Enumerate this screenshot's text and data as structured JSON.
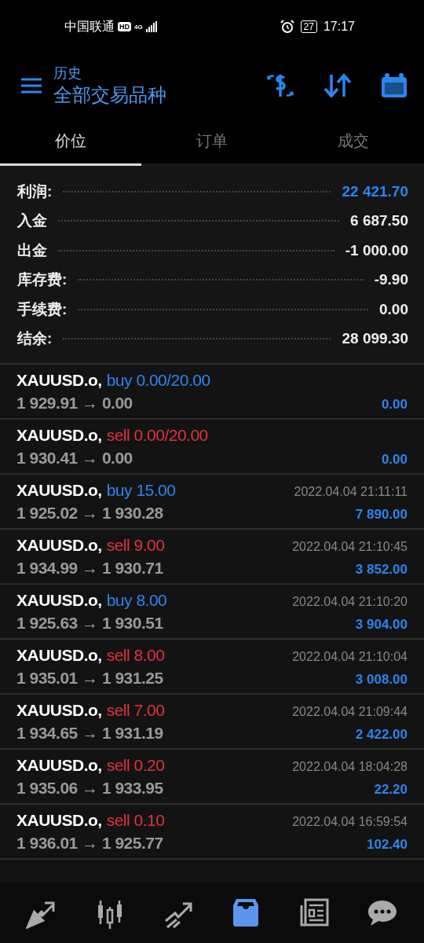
{
  "status_bar": {
    "carrier": "中国联通",
    "hd": "HD",
    "network": "4G",
    "battery": "27",
    "time": "17:17"
  },
  "header": {
    "subtitle": "历史",
    "title": "全部交易品种"
  },
  "tabs": [
    {
      "label": "价位",
      "selected": true
    },
    {
      "label": "订单",
      "selected": false
    },
    {
      "label": "成交",
      "selected": false
    }
  ],
  "summary": [
    {
      "label": "利润:",
      "value": "22 421.70",
      "highlight": true
    },
    {
      "label": "入金",
      "value": "6 687.50",
      "highlight": false
    },
    {
      "label": "出金",
      "value": "-1 000.00",
      "highlight": false
    },
    {
      "label": "库存费:",
      "value": "-9.90",
      "highlight": false
    },
    {
      "label": "手续费:",
      "value": "0.00",
      "highlight": false
    },
    {
      "label": "结余:",
      "value": "28 099.30",
      "highlight": false
    }
  ],
  "trades": [
    {
      "symbol": "XAUUSD.o,",
      "kind": "buy",
      "order": "buy 0.00/20.00",
      "prices": "1 929.91 → 0.00",
      "profit": "0.00"
    },
    {
      "symbol": "XAUUSD.o,",
      "kind": "sell",
      "order": "sell 0.00/20.00",
      "prices": "1 930.41 → 0.00",
      "profit": "0.00"
    },
    {
      "symbol": "XAUUSD.o,",
      "kind": "buy",
      "order": "buy 15.00",
      "prices": "1 925.02 → 1 930.28",
      "time": "2022.04.04 21:11:11",
      "profit": "7 890.00"
    },
    {
      "symbol": "XAUUSD.o,",
      "kind": "sell",
      "order": "sell 9.00",
      "prices": "1 934.99 → 1 930.71",
      "time": "2022.04.04 21:10:45",
      "profit": "3 852.00"
    },
    {
      "symbol": "XAUUSD.o,",
      "kind": "buy",
      "order": "buy 8.00",
      "prices": "1 925.63 → 1 930.51",
      "time": "2022.04.04 21:10:20",
      "profit": "3 904.00"
    },
    {
      "symbol": "XAUUSD.o,",
      "kind": "sell",
      "order": "sell 8.00",
      "prices": "1 935.01 → 1 931.25",
      "time": "2022.04.04 21:10:04",
      "profit": "3 008.00"
    },
    {
      "symbol": "XAUUSD.o,",
      "kind": "sell",
      "order": "sell 7.00",
      "prices": "1 934.65 → 1 931.19",
      "time": "2022.04.04 21:09:44",
      "profit": "2 422.00"
    },
    {
      "symbol": "XAUUSD.o,",
      "kind": "sell",
      "order": "sell 0.20",
      "prices": "1 935.06 → 1 933.95",
      "time": "2022.04.04 18:04:28",
      "profit": "22.20"
    },
    {
      "symbol": "XAUUSD.o,",
      "kind": "sell",
      "order": "sell 0.10",
      "prices": "1 936.01 → 1 925.77",
      "time": "2022.04.04 16:59:54",
      "profit": "102.40"
    }
  ],
  "nav": [
    {
      "kind": "trade",
      "selected": false
    },
    {
      "kind": "chart",
      "selected": false
    },
    {
      "kind": "trend",
      "selected": false
    },
    {
      "kind": "history",
      "selected": true
    },
    {
      "kind": "news",
      "selected": false
    },
    {
      "kind": "chat",
      "selected": false
    }
  ]
}
